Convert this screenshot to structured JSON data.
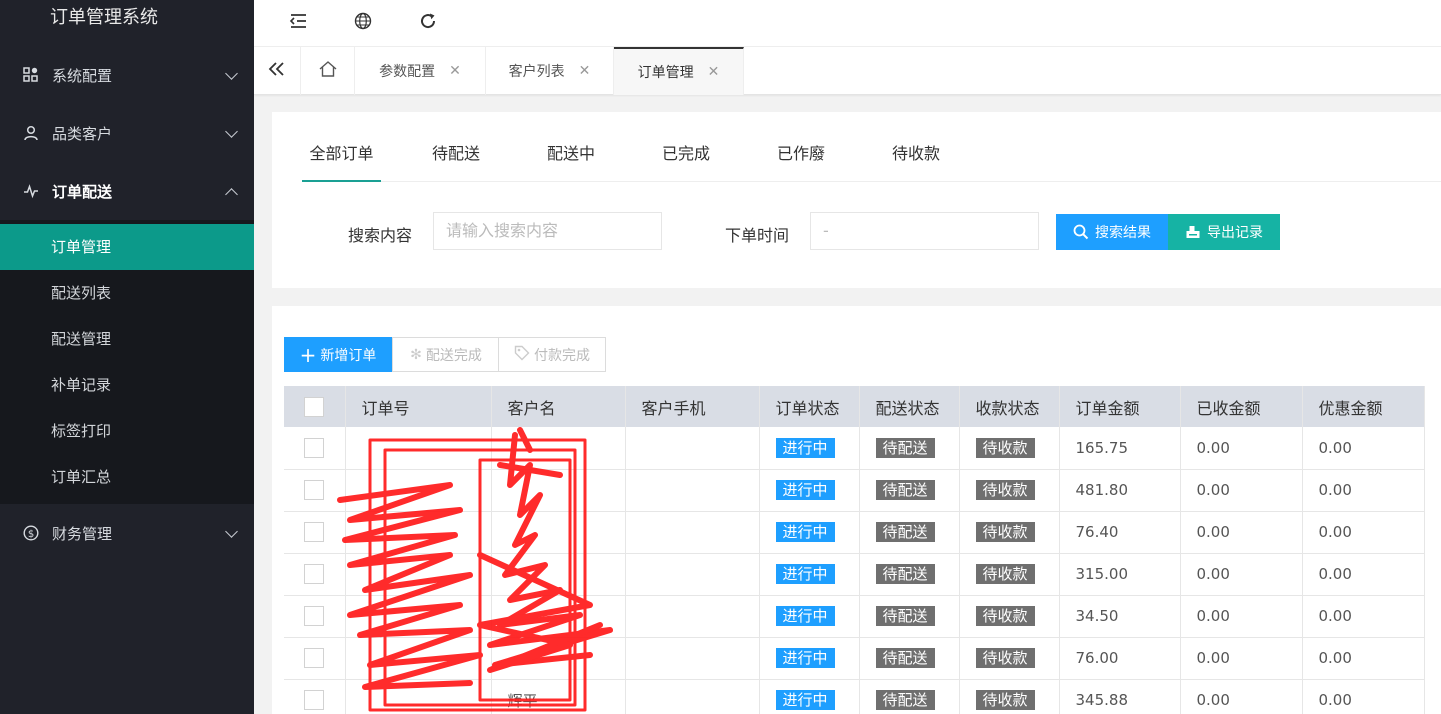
{
  "app": {
    "title": "订单管理系统"
  },
  "sidebar": {
    "groups": [
      {
        "label": "系统配置",
        "icon": "grid-icon",
        "expanded": false
      },
      {
        "label": "品类客户",
        "icon": "user-icon",
        "expanded": false
      },
      {
        "label": "订单配送",
        "icon": "pulse-icon",
        "expanded": true,
        "items": [
          "订单管理",
          "配送列表",
          "配送管理",
          "补单记录",
          "标签打印",
          "订单汇总"
        ]
      },
      {
        "label": "财务管理",
        "icon": "dollar-icon",
        "expanded": false
      }
    ]
  },
  "topbar": {
    "icons": [
      "menu-fold-icon",
      "globe-icon",
      "refresh-icon"
    ]
  },
  "tabs": [
    {
      "label": "参数配置"
    },
    {
      "label": "客户列表"
    },
    {
      "label": "订单管理"
    }
  ],
  "status_tabs": [
    "全部订单",
    "待配送",
    "配送中",
    "已完成",
    "已作廢",
    "待收款"
  ],
  "filters": {
    "search_label": "搜索内容",
    "search_placeholder": "请输入搜索内容",
    "time_label": "下单时间",
    "time_value": "-",
    "search_button": "搜索结果",
    "export_button": "导出记录"
  },
  "toolbar": {
    "add": "新增订单",
    "delivered": "配送完成",
    "paid": "付款完成"
  },
  "table": {
    "headers": [
      "订单号",
      "客户名",
      "客户手机",
      "订单状态",
      "配送状态",
      "收款状态",
      "订单金额",
      "已收金额",
      "优惠金额"
    ],
    "rows": [
      {
        "order_no": "",
        "customer": "",
        "phone": "",
        "status": "进行中",
        "delivery": "待配送",
        "payment": "待收款",
        "amount": "165.75",
        "received": "0.00",
        "discount": "0.00"
      },
      {
        "order_no": "",
        "customer": "",
        "phone": "",
        "status": "进行中",
        "delivery": "待配送",
        "payment": "待收款",
        "amount": "481.80",
        "received": "0.00",
        "discount": "0.00"
      },
      {
        "order_no": "",
        "customer": "",
        "phone": "",
        "status": "进行中",
        "delivery": "待配送",
        "payment": "待收款",
        "amount": "76.40",
        "received": "0.00",
        "discount": "0.00"
      },
      {
        "order_no": "",
        "customer": "",
        "phone": "",
        "status": "进行中",
        "delivery": "待配送",
        "payment": "待收款",
        "amount": "315.00",
        "received": "0.00",
        "discount": "0.00"
      },
      {
        "order_no": "",
        "customer": "",
        "phone": "",
        "status": "进行中",
        "delivery": "待配送",
        "payment": "待收款",
        "amount": "34.50",
        "received": "0.00",
        "discount": "0.00"
      },
      {
        "order_no": "",
        "customer": "",
        "phone": "",
        "status": "进行中",
        "delivery": "待配送",
        "payment": "待收款",
        "amount": "76.00",
        "received": "0.00",
        "discount": "0.00"
      },
      {
        "order_no": "",
        "customer": "辉平",
        "phone": "",
        "status": "进行中",
        "delivery": "待配送",
        "payment": "待收款",
        "amount": "345.88",
        "received": "0.00",
        "discount": "0.00"
      }
    ]
  },
  "colors": {
    "accent_teal": "#0c9a8a",
    "primary_blue": "#1e9fff",
    "sidebar_bg": "#20222a",
    "redaction": "#ff1a1a"
  }
}
